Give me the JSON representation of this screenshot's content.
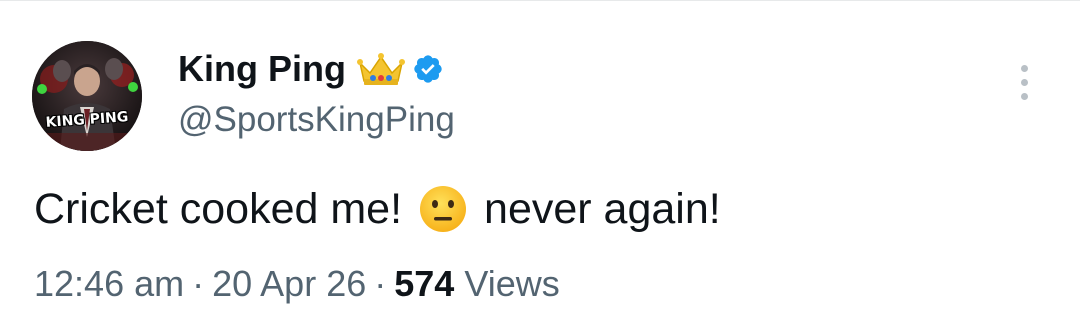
{
  "author": {
    "display_name": "King Ping",
    "handle": "@SportsKingPing",
    "avatar_caption": "KING PING",
    "badge_icons": [
      "crown-icon",
      "verified-badge-icon"
    ],
    "verified_color": "#1d9bf0"
  },
  "tweet": {
    "text_before_emoji": "Cricket cooked me!",
    "emoji": "neutral-face-icon",
    "text_after_emoji": "never again!"
  },
  "meta": {
    "time": "12:46 am",
    "separator": "·",
    "date": "20 Apr 26",
    "views_count": "574",
    "views_label": "Views"
  },
  "menu": {
    "icon": "more-vertical-icon"
  },
  "colors": {
    "primary_text": "#0f1419",
    "secondary_text": "#536471",
    "divider": "#e7e9ea"
  }
}
